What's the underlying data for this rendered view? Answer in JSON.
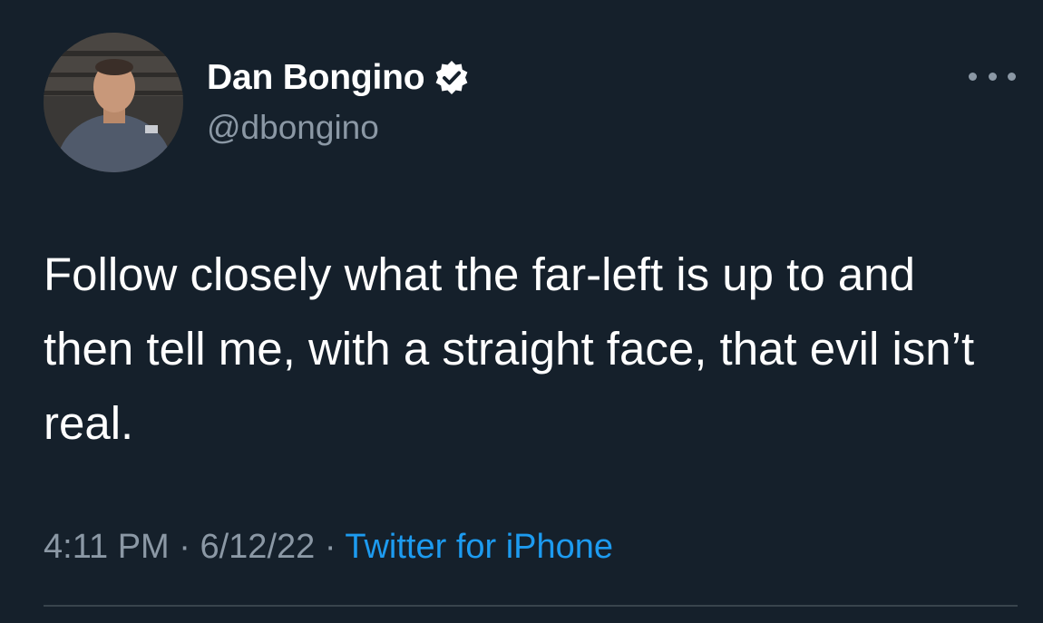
{
  "author": {
    "display_name": "Dan Bongino",
    "handle": "@dbongino",
    "verified": true,
    "avatar_icon": "profile-photo"
  },
  "tweet": {
    "text": "Follow closely what the far-left is up to and then tell me, with a straight face, that evil isn’t real."
  },
  "meta": {
    "time": "4:11 PM",
    "separator": "·",
    "date": "6/12/22",
    "source": "Twitter for iPhone"
  },
  "menu": {
    "icon": "more-options-icon"
  },
  "colors": {
    "background": "#15202b",
    "text_primary": "#ffffff",
    "text_secondary": "#8b98a5",
    "accent": "#1d9bf0",
    "divider": "#38444d"
  }
}
